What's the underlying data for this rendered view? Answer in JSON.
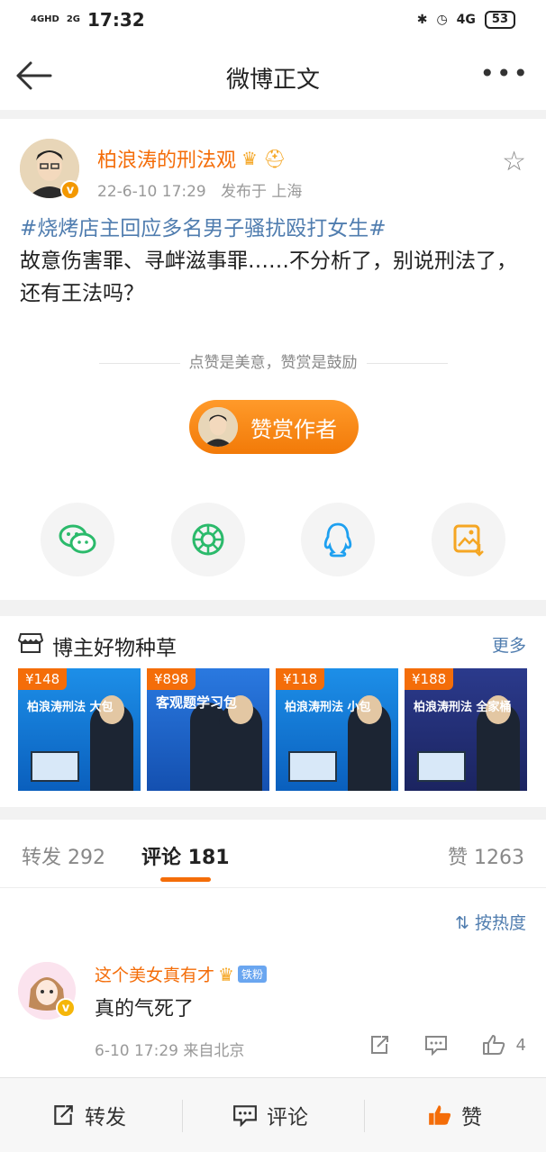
{
  "status_bar": {
    "signal1": "4GHD",
    "signal2": "2G",
    "time": "17:32",
    "network": "4G",
    "battery": "53"
  },
  "nav": {
    "title": "微博正文"
  },
  "post": {
    "author": "柏浪涛的刑法观",
    "time": "22-6-10 17:29",
    "location": "发布于 上海",
    "hashtag": "#烧烤店主回应多名男子骚扰殴打女生#",
    "body": "故意伤害罪、寻衅滋事罪……不分析了，别说刑法了，还有王法吗？"
  },
  "reward": {
    "tip": "点赞是美意，赞赏是鼓励",
    "button": "赞赏作者"
  },
  "share": {
    "icons": [
      "wechat-icon",
      "moments-icon",
      "qq-icon",
      "save-image-icon"
    ],
    "colors": {
      "wechat": "#2bba6b",
      "moments": "#2bba6b",
      "qq": "#1ea0f0",
      "save": "#f5a623"
    }
  },
  "goods": {
    "title": "博主好物种草",
    "more": "更多",
    "items": [
      {
        "price": "¥148",
        "title": "柏浪涛刑法 大包"
      },
      {
        "price": "¥898",
        "title": "客观题学习包"
      },
      {
        "price": "¥118",
        "title": "柏浪涛刑法 小包"
      },
      {
        "price": "¥188",
        "title": "柏浪涛刑法 全家桶"
      }
    ]
  },
  "tabs": {
    "repost": "转发 292",
    "comment": "评论 181",
    "like": "赞 1263"
  },
  "comments": {
    "sort": "按热度",
    "items": [
      {
        "name": "这个美女真有才",
        "badge": "铁粉",
        "text": "真的气死了",
        "time": "6-10 17:29  来自北京",
        "likes": "4"
      }
    ]
  },
  "bottom_bar": {
    "repost": "转发",
    "comment": "评论",
    "like": "赞"
  },
  "colors": {
    "accent": "#f46d09",
    "link": "#507daf"
  }
}
